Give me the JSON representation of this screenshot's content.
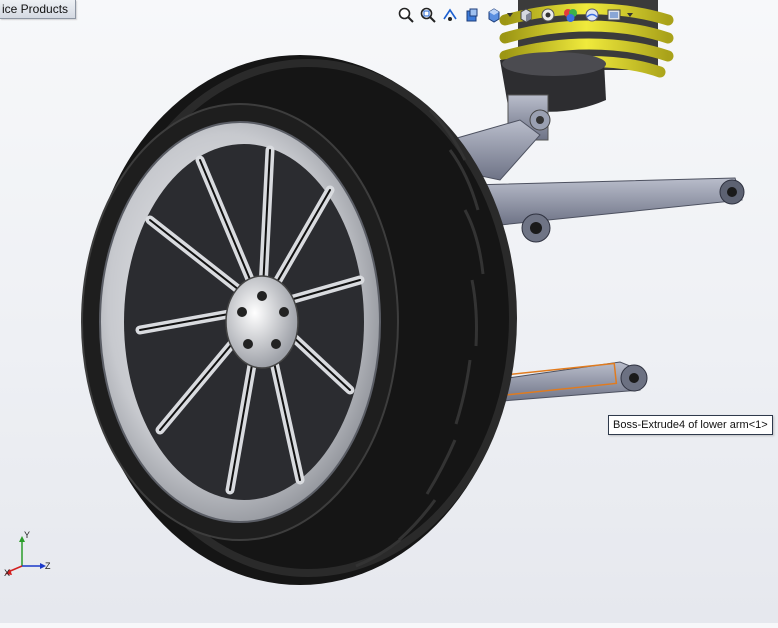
{
  "tab": {
    "label": "ice Products"
  },
  "toolbar": {
    "icons": [
      "zoom-to-fit-icon",
      "zoom-to-area-icon",
      "previous-view-icon",
      "section-view-icon",
      "view-orientation-icon",
      "display-style-icon",
      "hide-show-items-icon",
      "edit-appearance-icon",
      "apply-scene-icon",
      "view-settings-icon"
    ]
  },
  "tooltip": {
    "text": "Boss-Extrude4 of lower arm<1>"
  },
  "triad": {
    "x": "X",
    "y": "Y",
    "z": "Z"
  },
  "colors": {
    "tire": "#1b1b1b",
    "rim": "#c9cbcf",
    "arm": "#8d92a5",
    "spring": "#e4df2a",
    "highlight": "#e07b1f"
  }
}
